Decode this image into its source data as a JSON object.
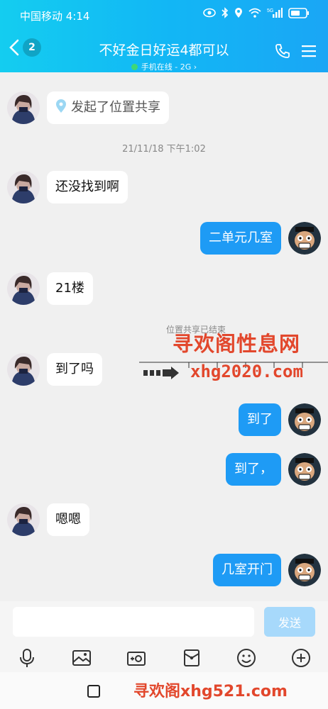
{
  "status_bar": {
    "carrier_time": "中国移动 4:14",
    "network": "5G"
  },
  "header": {
    "back_badge": "2",
    "title": "不好金日好运4都可以",
    "subtitle": "手机在线 - 2G ›"
  },
  "messages": [
    {
      "side": "left",
      "text": "发起了位置共享",
      "type": "location"
    },
    {
      "side": "left",
      "text": "还没找到啊"
    },
    {
      "side": "right",
      "text": "二单元几室"
    },
    {
      "side": "left",
      "text": "21楼"
    },
    {
      "side": "left",
      "text": "到了吗"
    },
    {
      "side": "right",
      "text": "到了"
    },
    {
      "side": "right",
      "text": "到了，"
    },
    {
      "side": "left",
      "text": "嗯嗯"
    },
    {
      "side": "right",
      "text": "几室开门"
    }
  ],
  "timestamp": "21/11/18 下午1:02",
  "system_note": "位置共享已结束",
  "watermarks": {
    "site_name": "寻欢阁性息网",
    "site_url": "xhg2020.com",
    "bottom": "寻欢阁xhg521.com"
  },
  "input": {
    "value": "",
    "send_label": "发送"
  },
  "colors": {
    "header": "#12b7f5",
    "outgoing_bubble": "#1e9bf5",
    "send_disabled": "#a7d9fb",
    "watermark": "#e2472c"
  }
}
